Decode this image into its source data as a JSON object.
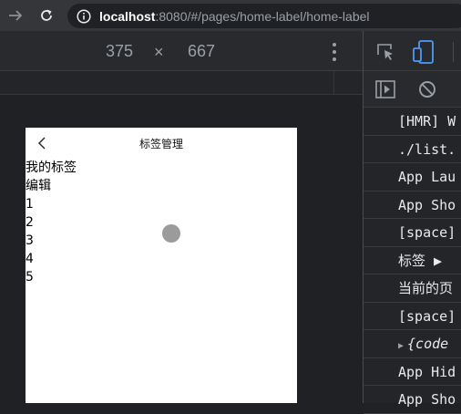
{
  "browser": {
    "url_host": "localhost",
    "url_rest": ":8080/#/pages/home-label/home-label",
    "icons": [
      "forward-arrow-icon",
      "reload-icon",
      "info-icon"
    ]
  },
  "device_toolbar": {
    "width": "375",
    "times": "×",
    "height": "667"
  },
  "phone": {
    "title": "标签管理",
    "back_icon": "chevron-left-icon",
    "lines": [
      "我的标签",
      "编辑",
      "1",
      "2",
      "3",
      "4",
      "5"
    ]
  },
  "devtools": {
    "icons": [
      "inspect-element-icon",
      "device-toggle-icon",
      "sidebar-toggle-icon",
      "clear-console-icon"
    ],
    "console_lines": [
      "[HMR] W",
      "./list.",
      "App Lau",
      "App Sho",
      "[space]",
      "标签  ▶",
      "当前的页",
      "[space]",
      "{code",
      "App Hid",
      "App Sho"
    ]
  },
  "colors": {
    "accent_blue": "#4e9bf5",
    "page_bg": "#202124",
    "touch_dot": "#9b9b9b"
  }
}
